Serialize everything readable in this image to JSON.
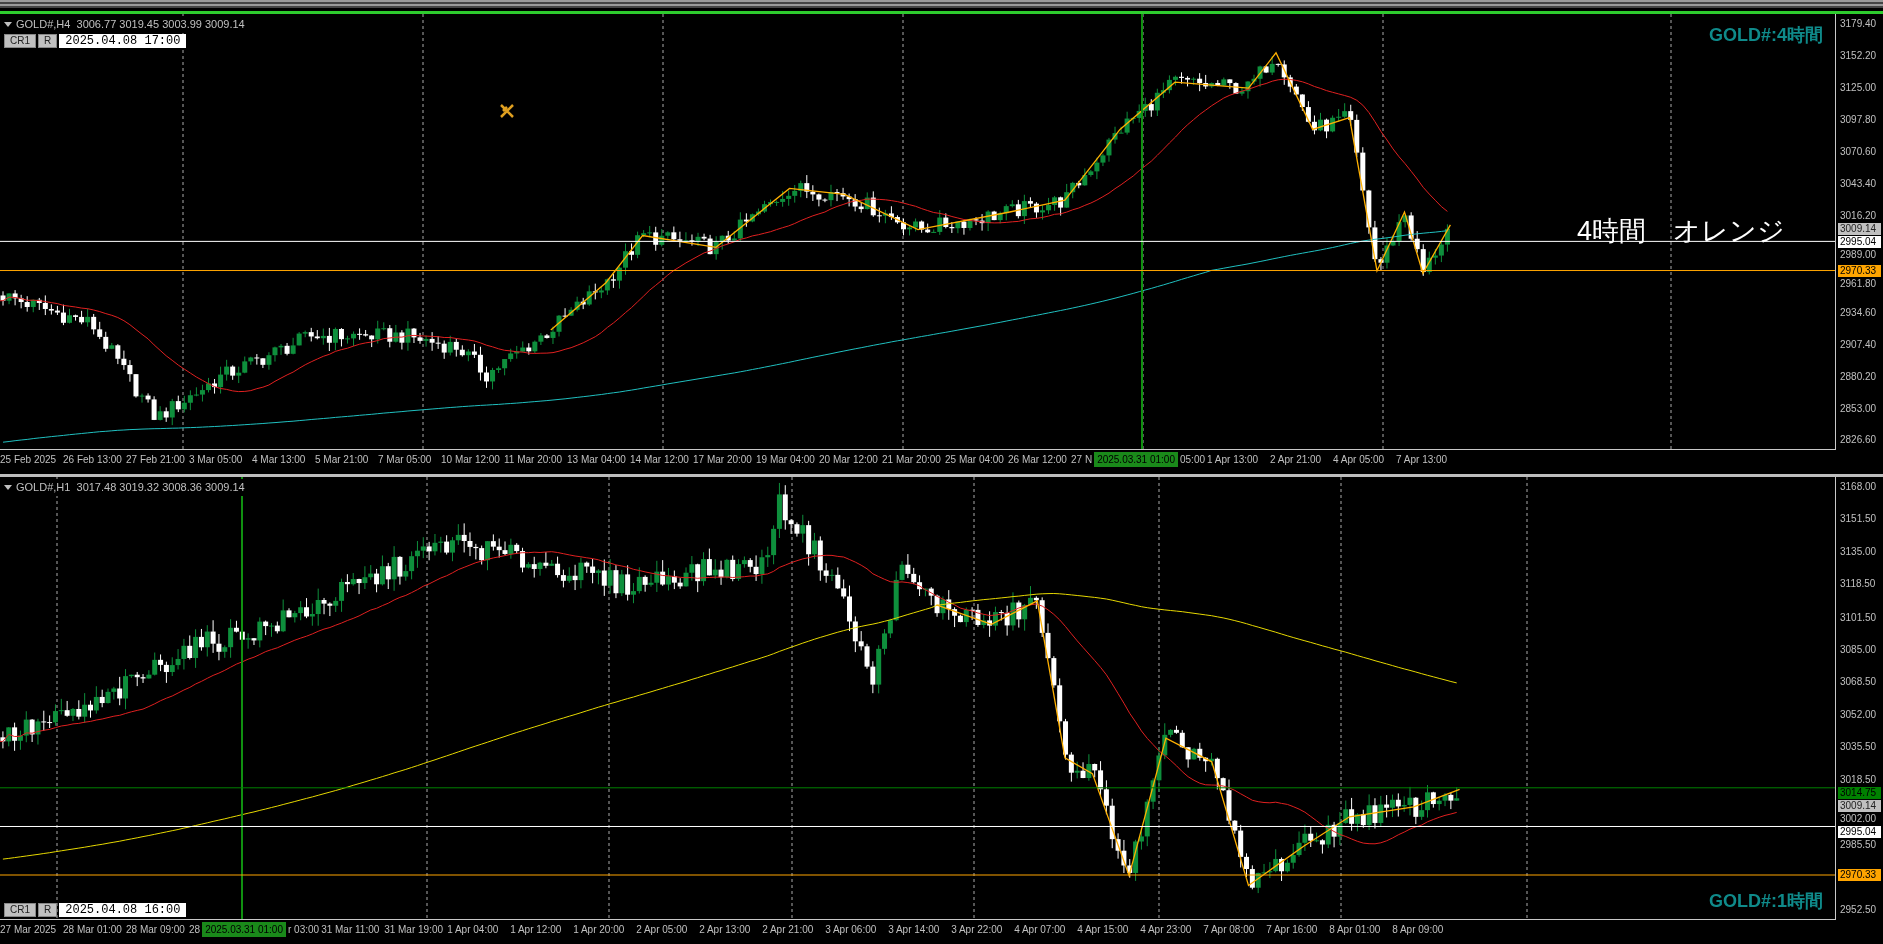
{
  "charts": [
    {
      "symbol_line": "GOLD#,H4  3006.77 3019.45 3003.99 3009.14",
      "selected": true,
      "label": "GOLD#:4時間",
      "note": "4時間　オレンジ",
      "buttons": [
        "CR1",
        "R"
      ],
      "date": "2025.04.08 17:00",
      "price_ticks": [
        "3179.40",
        "3152.20",
        "3125.00",
        "3097.80",
        "3070.60",
        "3043.40",
        "3016.20",
        "2989.00",
        "2961.80",
        "2934.60",
        "2907.40",
        "2880.20",
        "2853.00",
        "2826.60"
      ],
      "price_tags": [
        {
          "value": "3009.14",
          "kind": "bid",
          "color": "#c0c0c0"
        },
        {
          "value": "2995.04",
          "kind": "line",
          "color": "#ffffff"
        },
        {
          "value": "2970.33",
          "kind": "line",
          "color": "#ffa500"
        }
      ],
      "time_labels": [
        {
          "text": "25 Feb 2025",
          "kind": "tick"
        },
        {
          "text": "26 Feb 13:00",
          "kind": "tick"
        },
        {
          "text": "27 Feb 21:00",
          "kind": "tick"
        },
        {
          "text": "3 Mar 05:00",
          "kind": "tick"
        },
        {
          "text": "4 Mar 13:00",
          "kind": "tick"
        },
        {
          "text": "5 Mar 21:00",
          "kind": "tick"
        },
        {
          "text": "7 Mar 05:00",
          "kind": "tick"
        },
        {
          "text": "10 Mar 12:00",
          "kind": "tick"
        },
        {
          "text": "11 Mar 20:00",
          "kind": "tick"
        },
        {
          "text": "13 Mar 04:00",
          "kind": "tick"
        },
        {
          "text": "14 Mar 12:00",
          "kind": "tick"
        },
        {
          "text": "17 Mar 20:00",
          "kind": "tick"
        },
        {
          "text": "19 Mar 04:00",
          "kind": "tick"
        },
        {
          "text": "20 Mar 12:00",
          "kind": "tick"
        },
        {
          "text": "21 Mar 20:00",
          "kind": "tick"
        },
        {
          "text": "25 Mar 04:00",
          "kind": "tick"
        },
        {
          "text": "26 Mar 12:00",
          "kind": "tick"
        },
        {
          "text": "27 N",
          "kind": "cut"
        },
        {
          "text": "2025.03.31 01:00",
          "kind": "cursor"
        },
        {
          "text": "05:00",
          "kind": "cut"
        },
        {
          "text": "1 Apr 13:00",
          "kind": "tick"
        },
        {
          "text": "2 Apr 21:00",
          "kind": "tick"
        },
        {
          "text": "4 Apr 05:00",
          "kind": "tick"
        },
        {
          "text": "7 Apr 13:00",
          "kind": "tick"
        }
      ]
    },
    {
      "symbol_line": "GOLD#,H1  3017.48 3019.32 3008.36 3009.14",
      "selected": false,
      "label": "GOLD#:1時間",
      "buttons": [
        "CR1",
        "R"
      ],
      "date": "2025.04.08 16:00",
      "price_ticks": [
        "3168.00",
        "3151.50",
        "3135.00",
        "3118.50",
        "3101.50",
        "3085.00",
        "3068.50",
        "3052.00",
        "3035.50",
        "3018.50",
        "3002.00",
        "2985.50",
        "2952.50"
      ],
      "price_tags": [
        {
          "value": "3014.75",
          "kind": "line",
          "color": "#008000"
        },
        {
          "value": "3009.14",
          "kind": "bid",
          "color": "#c0c0c0"
        },
        {
          "value": "2995.04",
          "kind": "line",
          "color": "#ffffff"
        },
        {
          "value": "2970.33",
          "kind": "line",
          "color": "#ffa500"
        }
      ],
      "time_labels": [
        {
          "text": "27 Mar 2025",
          "kind": "tick"
        },
        {
          "text": "28 Mar 01:00",
          "kind": "tick"
        },
        {
          "text": "28 Mar 09:00",
          "kind": "tick"
        },
        {
          "text": "28",
          "kind": "cut"
        },
        {
          "text": "2025.03.31 01:00",
          "kind": "cursor"
        },
        {
          "text": "r 03:00",
          "kind": "cut"
        },
        {
          "text": "31 Mar 11:00",
          "kind": "tick"
        },
        {
          "text": "31 Mar 19:00",
          "kind": "tick"
        },
        {
          "text": "1 Apr 04:00",
          "kind": "tick"
        },
        {
          "text": "1 Apr 12:00",
          "kind": "tick"
        },
        {
          "text": "1 Apr 20:00",
          "kind": "tick"
        },
        {
          "text": "2 Apr 05:00",
          "kind": "tick"
        },
        {
          "text": "2 Apr 13:00",
          "kind": "tick"
        },
        {
          "text": "2 Apr 21:00",
          "kind": "tick"
        },
        {
          "text": "3 Apr 06:00",
          "kind": "tick"
        },
        {
          "text": "3 Apr 14:00",
          "kind": "tick"
        },
        {
          "text": "3 Apr 22:00",
          "kind": "tick"
        },
        {
          "text": "4 Apr 07:00",
          "kind": "tick"
        },
        {
          "text": "4 Apr 15:00",
          "kind": "tick"
        },
        {
          "text": "4 Apr 23:00",
          "kind": "tick"
        },
        {
          "text": "7 Apr 08:00",
          "kind": "tick"
        },
        {
          "text": "7 Apr 16:00",
          "kind": "tick"
        },
        {
          "text": "8 Apr 01:00",
          "kind": "tick"
        },
        {
          "text": "8 Apr 09:00",
          "kind": "tick"
        }
      ]
    }
  ]
}
